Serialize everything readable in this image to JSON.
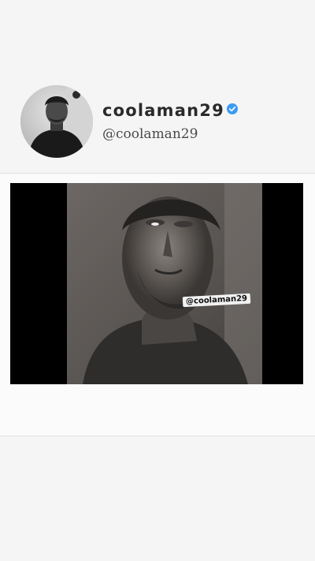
{
  "profile": {
    "username": "coolaman29",
    "handle": "@coolaman29",
    "verified": true,
    "verified_color": "#3b9cf2"
  },
  "media": {
    "watermark": "@coolaman29",
    "background_color": "#000000"
  }
}
